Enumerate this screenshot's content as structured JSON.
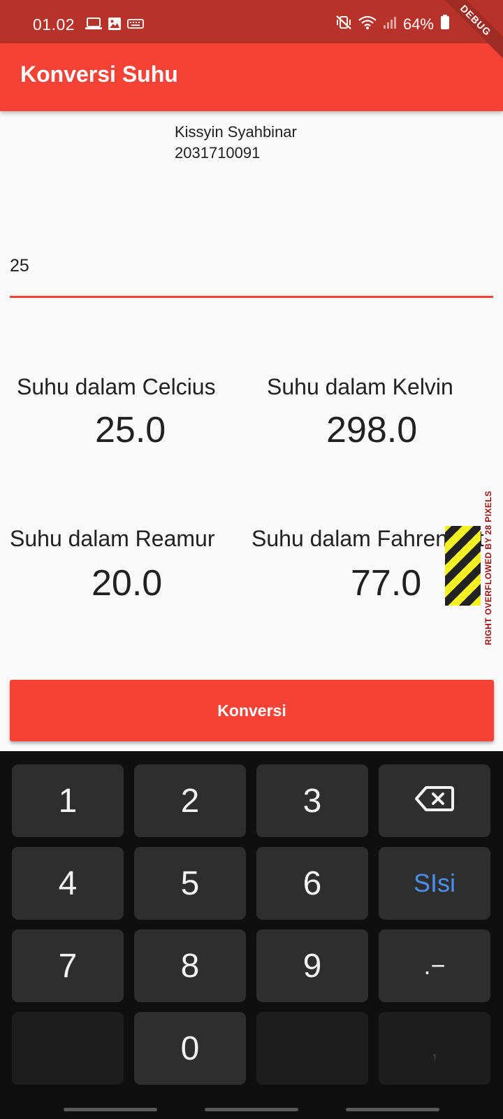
{
  "status_bar": {
    "time": "01.02",
    "battery": "64%",
    "left_icons": [
      "laptop-icon",
      "image-icon",
      "keyboard-icon"
    ],
    "right_icons": [
      "mute-vibrate-icon",
      "wifi-icon",
      "signal-icon",
      "battery-icon"
    ],
    "debug_banner": "DEBUG"
  },
  "app_bar": {
    "title": "Konversi Suhu"
  },
  "identity": {
    "name": "Kissyin Syahbinar",
    "id": "2031710091"
  },
  "input": {
    "value": "25"
  },
  "results": {
    "celcius": {
      "label": "Suhu dalam Celcius",
      "value": "25.0"
    },
    "kelvin": {
      "label": "Suhu dalam Kelvin",
      "value": "298.0"
    },
    "reamur": {
      "label": "Suhu dalam Reamur",
      "value": "20.0"
    },
    "fahrenheit": {
      "label": "Suhu dalam Fahrenheit",
      "value": "77.0"
    }
  },
  "overflow_warning": "RIGHT OVERFLOWED BY 28 PIXELS",
  "button": {
    "label": "Konversi"
  },
  "keyboard": {
    "rows": [
      [
        "1",
        "2",
        "3",
        ""
      ],
      [
        "4",
        "5",
        "6",
        "SIsi"
      ],
      [
        "7",
        "8",
        "9",
        ".−"
      ],
      [
        "",
        "0",
        "",
        ","
      ]
    ],
    "icons": {
      "backspace": "backspace-icon"
    }
  },
  "colors": {
    "primary": "#f44336",
    "status_bar": "#b7332a",
    "keyboard_bg": "#0f0f0f",
    "key_bg": "#2e2e2e",
    "key_action": "#4b8ff0"
  }
}
